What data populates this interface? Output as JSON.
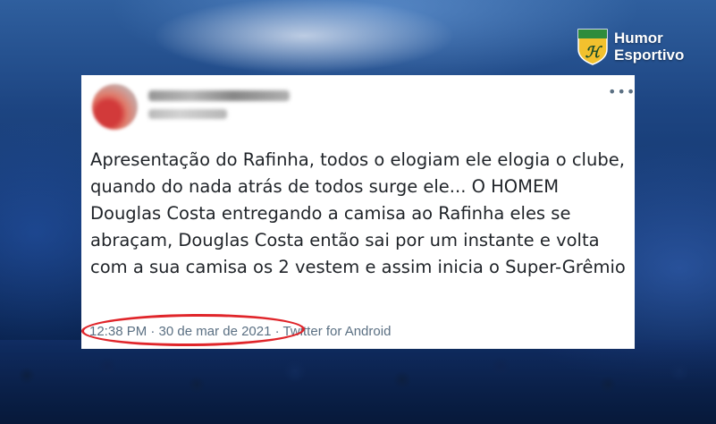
{
  "brand": {
    "logo_line1": "Humor",
    "logo_line2": "Esportivo",
    "logo_monogram": "HE",
    "shield_colors": {
      "top": "#2f8c3c",
      "bottom": "#f2c12e"
    }
  },
  "tweet": {
    "text": "Apresentação do Rafinha, todos o elogiam ele elogia o clube, quando do nada atrás de todos surge ele... O HOMEM Douglas Costa entregando a camisa ao Rafinha eles se abraçam, Douglas Costa então sai por um instante e volta com a sua camisa os 2 vestem e assim inicia o Super-Grêmio",
    "timestamp": "12:38 PM · 30 de mar de 2021 · Twitter for Android",
    "more_icon": "more-horizontal-icon",
    "highlight_color": "#e0252a"
  }
}
